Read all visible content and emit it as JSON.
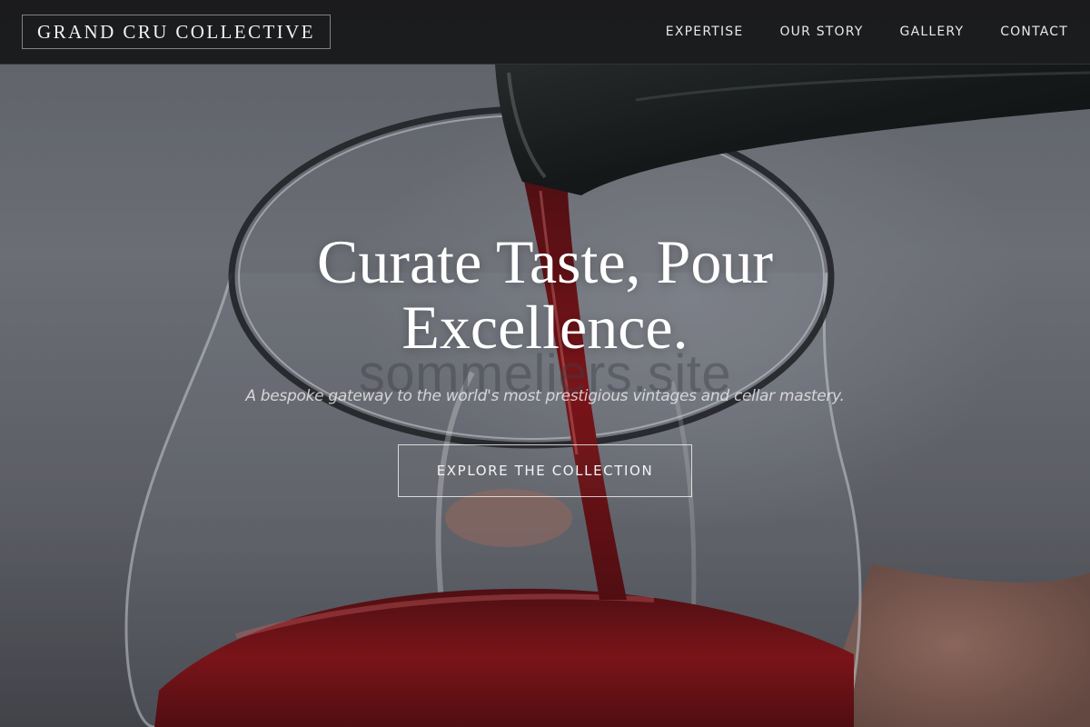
{
  "brand": {
    "logo_text": "GRAND CRU COLLECTIVE"
  },
  "nav": {
    "items": [
      {
        "label": "EXPERTISE"
      },
      {
        "label": "OUR STORY"
      },
      {
        "label": "GALLERY"
      },
      {
        "label": "CONTACT"
      }
    ]
  },
  "hero": {
    "title_line1": "Curate Taste, Pour",
    "title_line2": "Excellence.",
    "watermark": "sommeliers.site",
    "subtitle": "A bespoke gateway to the world's most prestigious vintages and cellar mastery.",
    "cta_label": "EXPLORE THE COLLECTION",
    "image_subject": "red wine being poured from a bottle into a glass"
  },
  "colors": {
    "navbar_bg": "#161618",
    "text_primary": "#ffffff",
    "wine_red": "#8f1216"
  }
}
